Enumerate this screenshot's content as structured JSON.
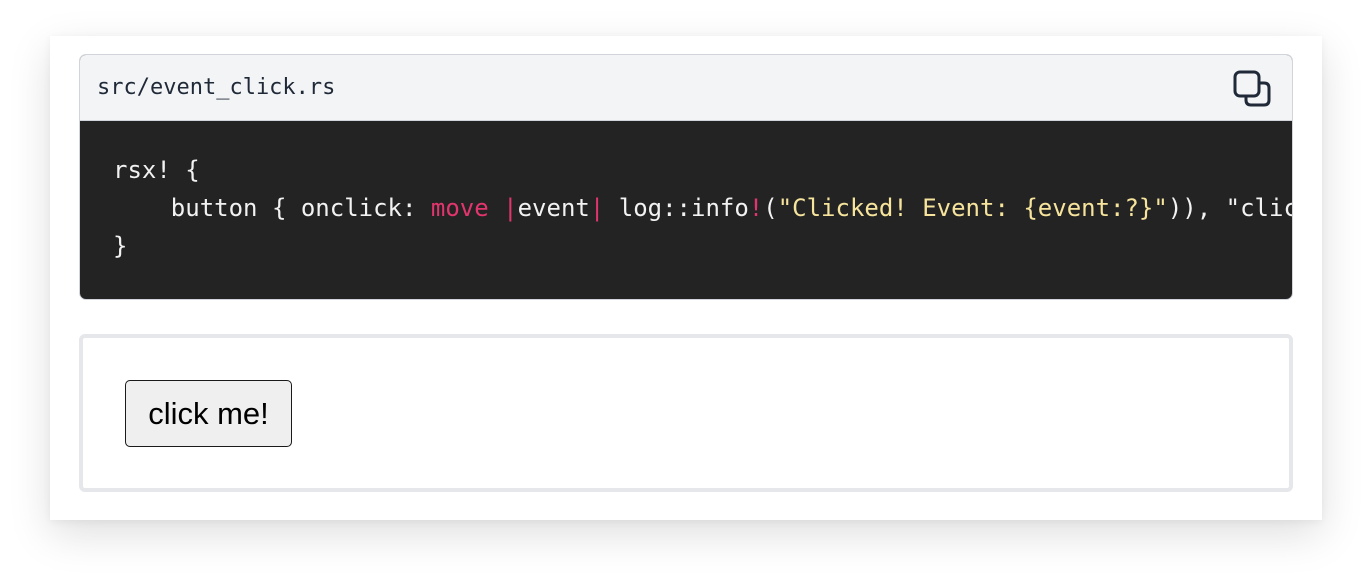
{
  "code_block": {
    "filename": "src/event_click.rs",
    "copy_icon": "copy-icon",
    "lines": [
      [
        {
          "text": "rsx! {",
          "kind": "plain"
        }
      ],
      [
        {
          "text": "    button { onclick: ",
          "kind": "plain"
        },
        {
          "text": "move",
          "kind": "kw"
        },
        {
          "text": " ",
          "kind": "plain"
        },
        {
          "text": "|",
          "kind": "kw"
        },
        {
          "text": "event",
          "kind": "plain"
        },
        {
          "text": "|",
          "kind": "kw"
        },
        {
          "text": " log::info",
          "kind": "plain"
        },
        {
          "text": "!",
          "kind": "kw"
        },
        {
          "text": "(",
          "kind": "plain"
        },
        {
          "text": "\"Clicked! Event: {event:?}\"",
          "kind": "str"
        },
        {
          "text": ")), \"click me!\" }",
          "kind": "plain"
        }
      ],
      [
        {
          "text": "}",
          "kind": "plain"
        }
      ]
    ]
  },
  "demo": {
    "button_label": "click me!"
  },
  "colors": {
    "keyword": "#e3356d",
    "string": "#f6e49c",
    "code_bg": "#232323",
    "header_bg": "#f3f4f6"
  }
}
